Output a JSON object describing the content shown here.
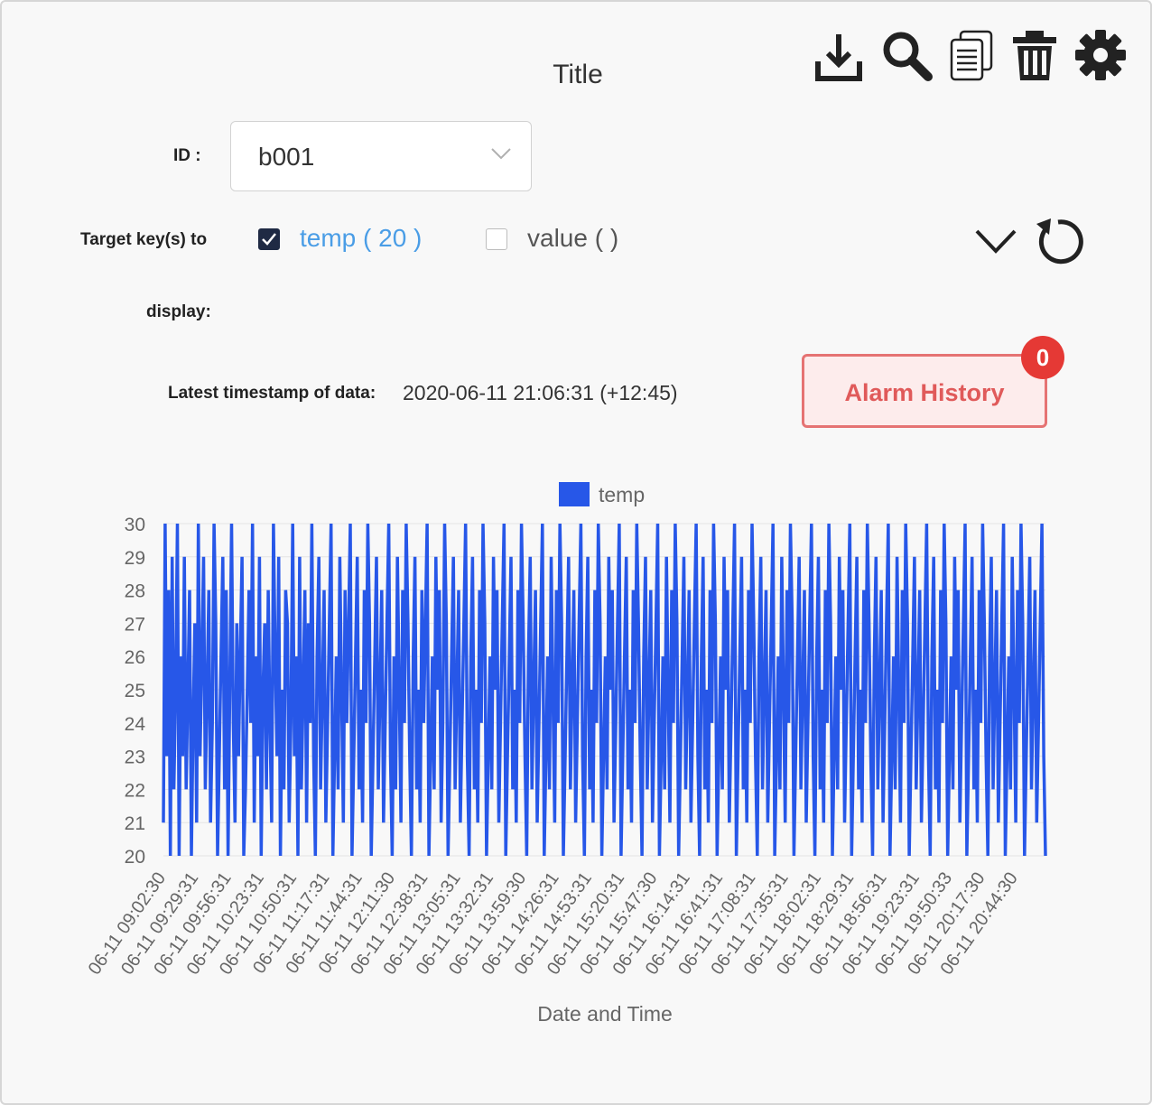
{
  "widget": {
    "title": "Title"
  },
  "toolbar": {
    "items": [
      {
        "name": "download-icon"
      },
      {
        "name": "search-icon"
      },
      {
        "name": "copy-icon"
      },
      {
        "name": "trash-icon"
      },
      {
        "name": "gear-icon"
      }
    ]
  },
  "filters": {
    "id_label": "ID :",
    "id_value": "b001",
    "target_label": "Target key(s) to",
    "display_label": "display:",
    "keys": [
      {
        "label": "temp ( 20 )",
        "checked": true
      },
      {
        "label": "value ( )",
        "checked": false
      }
    ]
  },
  "status": {
    "timestamp_label": "Latest timestamp of data:",
    "timestamp_value": "2020-06-11 21:06:31 (+12:45)"
  },
  "alarm": {
    "label": "Alarm History",
    "count": "0",
    "color": "#e57373"
  },
  "chart_data": {
    "type": "line",
    "legend": [
      "temp"
    ],
    "legend_placement": "top",
    "xlabel": "Date and Time",
    "ylabel": "",
    "ylim": [
      20,
      30
    ],
    "y_ticks": [
      "30",
      "29",
      "28",
      "27",
      "26",
      "25",
      "24",
      "23",
      "22",
      "21",
      "20"
    ],
    "grid": true,
    "x_tick_labels": [
      "06-11 09:02:30",
      "06-11 09:29:31",
      "06-11 09:56:31",
      "06-11 10:23:31",
      "06-11 10:50:31",
      "06-11 11:17:31",
      "06-11 11:44:31",
      "06-11 12:11:30",
      "06-11 12:38:31",
      "06-11 13:05:31",
      "06-11 13:32:31",
      "06-11 13:59:30",
      "06-11 14:26:31",
      "06-11 14:53:31",
      "06-11 15:20:31",
      "06-11 15:47:30",
      "06-11 16:14:31",
      "06-11 16:41:31",
      "06-11 17:08:31",
      "06-11 17:35:31",
      "06-11 18:02:31",
      "06-11 18:29:31",
      "06-11 18:56:31",
      "06-11 19:23:31",
      "06-11 19:50:33",
      "06-11 20:17:30",
      "06-11 20:44:30"
    ],
    "series": [
      {
        "name": "temp",
        "color": "#2757e8",
        "values": [
          21,
          30,
          23,
          28,
          20,
          29,
          22,
          25,
          30,
          20,
          26,
          23,
          29,
          22,
          25,
          28,
          20,
          24,
          27,
          21,
          30,
          23,
          26,
          29,
          22,
          25,
          28,
          21,
          24,
          30,
          27,
          20,
          23,
          26,
          29,
          22,
          28,
          20,
          25,
          30,
          24,
          21,
          27,
          23,
          26,
          29,
          20,
          22,
          25,
          28,
          24,
          30,
          21,
          26,
          23,
          29,
          20,
          25,
          27,
          22,
          28,
          24,
          21,
          30,
          26,
          23,
          29,
          20,
          25,
          22,
          28,
          27,
          21,
          24,
          30,
          23,
          26,
          20,
          29,
          22,
          25,
          28,
          21,
          27,
          24,
          30,
          23,
          20,
          26,
          29,
          22,
          25,
          28,
          21,
          24,
          27,
          30,
          20,
          23,
          26,
          22,
          29,
          25,
          21,
          28,
          24,
          27,
          30,
          20,
          23,
          26,
          29,
          22,
          25,
          21,
          28,
          24,
          30,
          27,
          20,
          23,
          26,
          29,
          22,
          25,
          28,
          21,
          24,
          27,
          30,
          23,
          20,
          26,
          22,
          29,
          25,
          21,
          28,
          24,
          30,
          27,
          23,
          20,
          26,
          29,
          22,
          25,
          21,
          28,
          24,
          27,
          30,
          20,
          23,
          26,
          22,
          29,
          25,
          28,
          21,
          24,
          30,
          27,
          20,
          23,
          26,
          29,
          22,
          25,
          28,
          21,
          24,
          27,
          30,
          23,
          20,
          26,
          29,
          22,
          25,
          21,
          28,
          24,
          30,
          27,
          20,
          23,
          26,
          22,
          29,
          25,
          28,
          21,
          24,
          27,
          30,
          20,
          23,
          26,
          29,
          22,
          25,
          21,
          28,
          24,
          30,
          27,
          23,
          20,
          26,
          29,
          22,
          25,
          28,
          21,
          24,
          27,
          30,
          20,
          23,
          26,
          22,
          29,
          25,
          21,
          28,
          24,
          30,
          27,
          20,
          23,
          26,
          29,
          22,
          25,
          28,
          21,
          24,
          27,
          30,
          23,
          20,
          26,
          29,
          22,
          25,
          21,
          28,
          24,
          30,
          27,
          20,
          23,
          26,
          22,
          29,
          25,
          28,
          21,
          24,
          27,
          30,
          20,
          23,
          26,
          29,
          22,
          25,
          21,
          28,
          24,
          30,
          27,
          23,
          20,
          26,
          29,
          22,
          25,
          28,
          21,
          24,
          27,
          30,
          20,
          23,
          26,
          22,
          29,
          25,
          21,
          28,
          24,
          30,
          27,
          20,
          23,
          26,
          29,
          22,
          25,
          28,
          21,
          24,
          27,
          30,
          23,
          20,
          26,
          29,
          22,
          25,
          21,
          28,
          24,
          30,
          27,
          20,
          23,
          26,
          22,
          29,
          25,
          28,
          21,
          24,
          27,
          30,
          20,
          23,
          26,
          29,
          22,
          25,
          21,
          28,
          24,
          30,
          27,
          23,
          20,
          26,
          29,
          22,
          25,
          28,
          21,
          24,
          27,
          30,
          20,
          23,
          26,
          22,
          29,
          25,
          21,
          28,
          24,
          30,
          27,
          20,
          23,
          26,
          29,
          22,
          25,
          28,
          21,
          24,
          27,
          30,
          23,
          20,
          26,
          29,
          22,
          25,
          21,
          28,
          24,
          30,
          27,
          20,
          23,
          26,
          22,
          29,
          25,
          28,
          21,
          24,
          27,
          30,
          20,
          23,
          26,
          29,
          22,
          25,
          21,
          28,
          24,
          30,
          27,
          23,
          20,
          26,
          29,
          22,
          25,
          28,
          21,
          24,
          27,
          30,
          20,
          23,
          26,
          22,
          29,
          25,
          21,
          28,
          24,
          30,
          27,
          20,
          23,
          26,
          29,
          22,
          25,
          28,
          21,
          24,
          27,
          30,
          23,
          20,
          26,
          29,
          22,
          25,
          21,
          28,
          24,
          30,
          27,
          20,
          23,
          26,
          22,
          29,
          25,
          28,
          21,
          24,
          27,
          30,
          20,
          23,
          26,
          29,
          22,
          25,
          21,
          28,
          24,
          30,
          27,
          23,
          20,
          26,
          29,
          22,
          25,
          28,
          21,
          24,
          27,
          30,
          20,
          23,
          26,
          22,
          29,
          25,
          21,
          28,
          24,
          30,
          27,
          20,
          23,
          26,
          29,
          22,
          25,
          28,
          21,
          24,
          27,
          30,
          23,
          20
        ]
      }
    ]
  }
}
